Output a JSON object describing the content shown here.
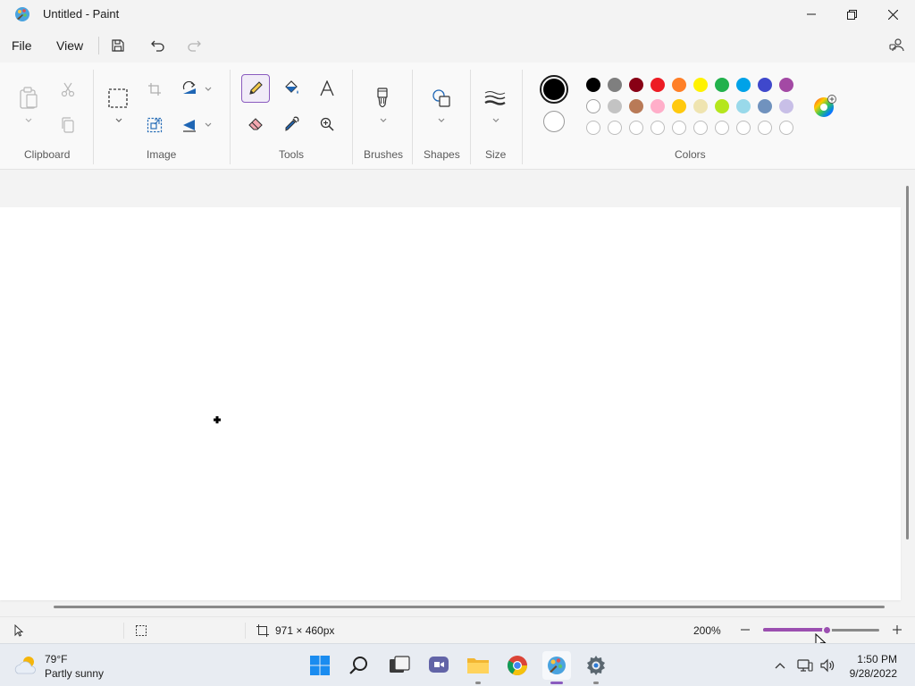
{
  "window": {
    "title": "Untitled - Paint"
  },
  "menu": {
    "file": "File",
    "view": "View"
  },
  "ribbon": {
    "groups": {
      "clipboard": "Clipboard",
      "image": "Image",
      "tools": "Tools",
      "brushes": "Brushes",
      "shapes": "Shapes",
      "size": "Size",
      "colors": "Colors"
    },
    "primary_color": "#000000",
    "secondary_color": "#ffffff",
    "palette_row1": [
      "#000000",
      "#7f7f7f",
      "#880015",
      "#ed1c24",
      "#ff7f27",
      "#fff200",
      "#22b14c",
      "#00a2e8",
      "#3f48cc",
      "#a349a4"
    ],
    "palette_row2": [
      "#ffffff",
      "#c3c3c3",
      "#b97a57",
      "#ffaec9",
      "#ffc90e",
      "#efe4b0",
      "#b5e61d",
      "#99d9ea",
      "#7092be",
      "#c8bfe7"
    ],
    "palette_row3_count": 10
  },
  "statusbar": {
    "canvas_size": "971 × 460px",
    "zoom": "200%",
    "zoom_fraction": 0.55
  },
  "taskbar": {
    "weather_temp": "79°F",
    "weather_desc": "Partly sunny",
    "time": "1:50 PM",
    "date": "9/28/2022"
  },
  "colors": {
    "accent": "#8a5bbf",
    "zoom_track": "#9b4fb0"
  }
}
